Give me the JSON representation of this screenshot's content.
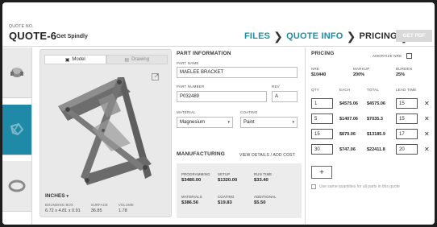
{
  "header": {
    "quote_no_label": "QUOTE NO.",
    "quote_title": "QUOTE-6",
    "customer": "Get Spindly",
    "steps": [
      "FILES",
      "QUOTE INFO",
      "PRICING"
    ],
    "active_step": "PRICING",
    "get_pdf_label": "GET PDF"
  },
  "viewer": {
    "tabs": [
      {
        "label": "Model",
        "icon": "cube-icon"
      },
      {
        "label": "Drawing",
        "icon": "drawing-icon"
      }
    ],
    "units": "INCHES",
    "dims": [
      {
        "label": "BOUNDING BOX",
        "value": "6.72 x 4.81 x 0.91"
      },
      {
        "label": "SURFACE",
        "value": "36.85"
      },
      {
        "label": "VOLUME",
        "value": "1.78"
      }
    ]
  },
  "part_info": {
    "title": "PART INFORMATION",
    "part_name_label": "PART NAME",
    "part_name": "MAELEE BRACKET",
    "part_number_label": "PART NUMBER",
    "part_number": "P032489",
    "rev_label": "REV",
    "rev": "A",
    "material_label": "MATERIAL",
    "material": "Magnesium",
    "coating_label": "COATING",
    "coating": "Paint"
  },
  "manufacturing": {
    "title": "MANUFACTURING",
    "link": "VIEW DETAILS / ADD COST",
    "costs": [
      {
        "label": "PROGRAMMING",
        "value": "$3480.00"
      },
      {
        "label": "SETUP",
        "value": "$1320.00"
      },
      {
        "label": "RUN TIME",
        "value": "$33.40"
      },
      {
        "label": "MATERIALS",
        "value": "$386.56"
      },
      {
        "label": "COATING",
        "value": "$19.83"
      },
      {
        "label": "ADDITIONAL",
        "value": "$5.50"
      }
    ]
  },
  "pricing": {
    "title": "PRICING",
    "amortize_label": "AMORTIZE NRE",
    "nre_label": "NRE",
    "nre": "$10440",
    "markup_label": "MARKUP",
    "markup": "200%",
    "burden_label": "BURDEN",
    "burden": "25%",
    "columns": [
      "QTY",
      "EACH",
      "TOTAL",
      "LEAD TIME"
    ],
    "rows": [
      {
        "qty": "1",
        "each": "$4575.06",
        "total": "$4575.06",
        "lead": "15"
      },
      {
        "qty": "5",
        "each": "$1407.06",
        "total": "$7035.3",
        "lead": "15"
      },
      {
        "qty": "15",
        "each": "$879.06",
        "total": "$13185.9",
        "lead": "17"
      },
      {
        "qty": "30",
        "each": "$747.06",
        "total": "$22411.8",
        "lead": "20"
      }
    ],
    "add_label": "+",
    "same_qty_label": "Use same quantities for all parts in this quote"
  },
  "colors": {
    "accent": "#1f8aa7",
    "step_inactive": "#1d8ea8"
  }
}
